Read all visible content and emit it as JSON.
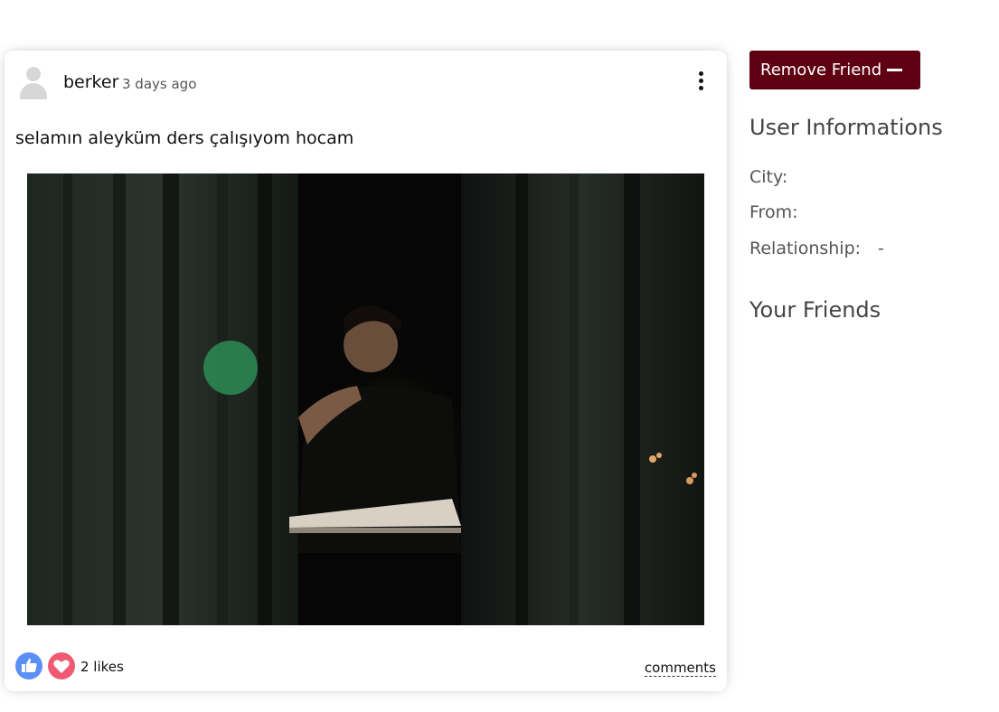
{
  "post": {
    "username": "berker",
    "date": "3 days ago",
    "text": "selamın aleyküm ders çalışıyom hocam",
    "image_alt": "Man studying at a desk at night",
    "likes": "2 likes",
    "comments_label": "comments"
  },
  "sidebar": {
    "remove_friend_label": "Remove Friend",
    "user_info_title": "User Informations",
    "city_label": "City:",
    "city_value": "",
    "from_label": "From:",
    "from_value": "",
    "relationship_label": "Relationship:",
    "relationship_value": "-",
    "friends_title": "Your Friends"
  },
  "colors": {
    "remove_button": "#5e0012",
    "like": "#5a8ff5",
    "heart": "#ef5a72"
  },
  "icons": [
    "person-avatar-icon",
    "more-vertical-icon",
    "thumbs-up-icon",
    "heart-icon",
    "minus-icon"
  ]
}
